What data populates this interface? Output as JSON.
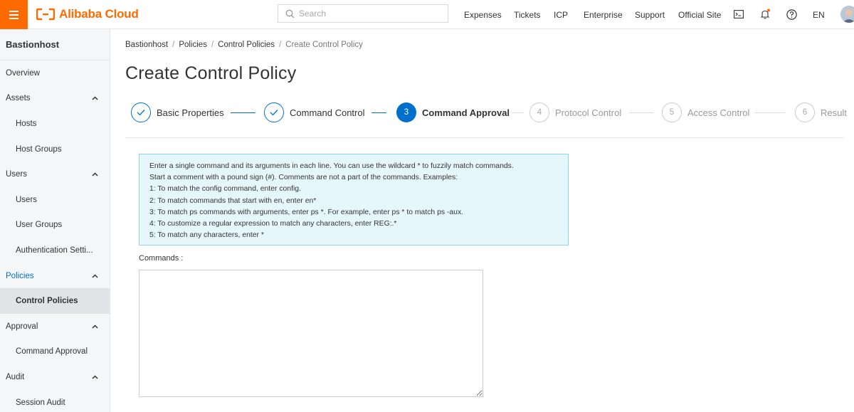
{
  "topbar": {
    "brand": "Alibaba Cloud",
    "search_placeholder": "Search",
    "nav": [
      "Expenses",
      "Tickets",
      "ICP",
      "Enterprise",
      "Support",
      "Official Site"
    ],
    "language": "EN",
    "colors": {
      "brand": "#ff6a00"
    }
  },
  "sidebar": {
    "title": "Bastionhost",
    "items": [
      {
        "label": "Overview"
      },
      {
        "label": "Assets"
      },
      {
        "label": "Hosts"
      },
      {
        "label": "Host Groups"
      },
      {
        "label": "Users"
      },
      {
        "label": "Users"
      },
      {
        "label": "User Groups"
      },
      {
        "label": "Authentication Setti..."
      },
      {
        "label": "Policies"
      },
      {
        "label": "Control Policies"
      },
      {
        "label": "Approval"
      },
      {
        "label": "Command Approval"
      },
      {
        "label": "Audit"
      },
      {
        "label": "Session Audit"
      }
    ]
  },
  "breadcrumb": [
    "Bastionhost",
    "Policies",
    "Control Policies",
    "Create Control Policy"
  ],
  "page_title": "Create Control Policy",
  "steps": [
    {
      "number": "1",
      "label": "Basic Properties",
      "status": "done"
    },
    {
      "number": "2",
      "label": "Command Control",
      "status": "done"
    },
    {
      "number": "3",
      "label": "Command Approval",
      "status": "current"
    },
    {
      "number": "4",
      "label": "Protocol Control",
      "status": "pending"
    },
    {
      "number": "5",
      "label": "Access Control",
      "status": "pending"
    },
    {
      "number": "6",
      "label": "Result",
      "status": "pending"
    }
  ],
  "tip": {
    "lines": [
      "Enter a single command and its arguments in each line. You can use the wildcard * to fuzzily match commands.",
      "Start a comment with a pound sign (#). Comments are not a part of the commands. Examples:",
      "1: To match the config command, enter config.",
      "2: To match commands that start with en, enter en*",
      "3: To match ps commands with arguments, enter ps *. For example, enter ps * to match ps -aux.",
      "4: To customize a regular expression to match any characters, enter REG:.*",
      "5: To match any characters, enter *"
    ]
  },
  "commands": {
    "label": "Commands :",
    "value": ""
  },
  "colors": {
    "primary": "#0070cc",
    "tip_bg": "#e6f7fb",
    "tip_border": "#8fd4ea"
  }
}
